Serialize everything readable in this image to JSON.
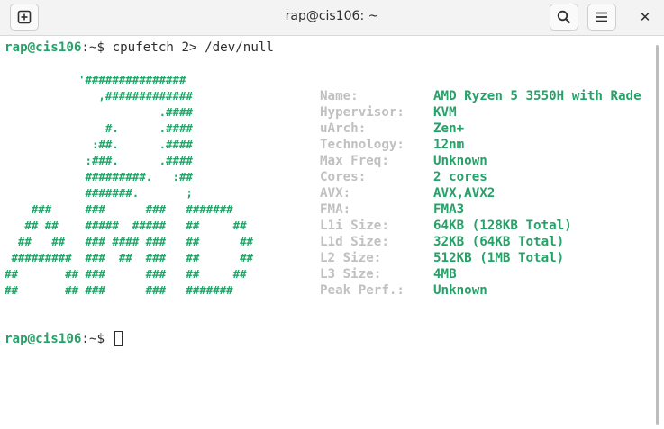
{
  "window": {
    "title": "rap@cis106: ~",
    "new_tab_icon": "new-tab-icon",
    "search_icon": "search-icon",
    "menu_icon": "hamburger-menu-icon",
    "close_icon": "close-icon",
    "close_glyph": "✕"
  },
  "terminal": {
    "prompt_user": "rap@cis106",
    "prompt_path": ":~$ ",
    "command": "cpufetch 2> /dev/null",
    "ascii_color": "#26a269",
    "ascii": [
      "           '###############",
      "              ,#############",
      "                       .####",
      "               #.      .####",
      "             :##.      .####",
      "            :###.      .####",
      "            #########.   :##",
      "            #######.       ;",
      "    ###     ###      ###   #######",
      "   ## ##    #####  #####   ##     ##",
      "  ##   ##   ### #### ###   ##      ##",
      " #########  ###  ##  ###   ##      ##",
      "##       ## ###      ###   ##     ##",
      "##       ## ###      ###   #######"
    ],
    "info": [
      {
        "key": "Name:",
        "value": "AMD Ryzen 5 3550H with Rade"
      },
      {
        "key": "Hypervisor:",
        "value": "KVM"
      },
      {
        "key": "uArch:",
        "value": "Zen+"
      },
      {
        "key": "Technology:",
        "value": "12nm"
      },
      {
        "key": "Max Freq:",
        "value": "Unknown"
      },
      {
        "key": "Cores:",
        "value": "2 cores"
      },
      {
        "key": "AVX:",
        "value": "AVX,AVX2"
      },
      {
        "key": "FMA:",
        "value": "FMA3"
      },
      {
        "key": "L1i Size:",
        "value": "64KB (128KB Total)"
      },
      {
        "key": "L1d Size:",
        "value": "32KB (64KB Total)"
      },
      {
        "key": "L2 Size:",
        "value": "512KB (1MB Total)"
      },
      {
        "key": "L3 Size:",
        "value": "4MB"
      },
      {
        "key": "Peak Perf.:",
        "value": "Unknown"
      }
    ]
  }
}
